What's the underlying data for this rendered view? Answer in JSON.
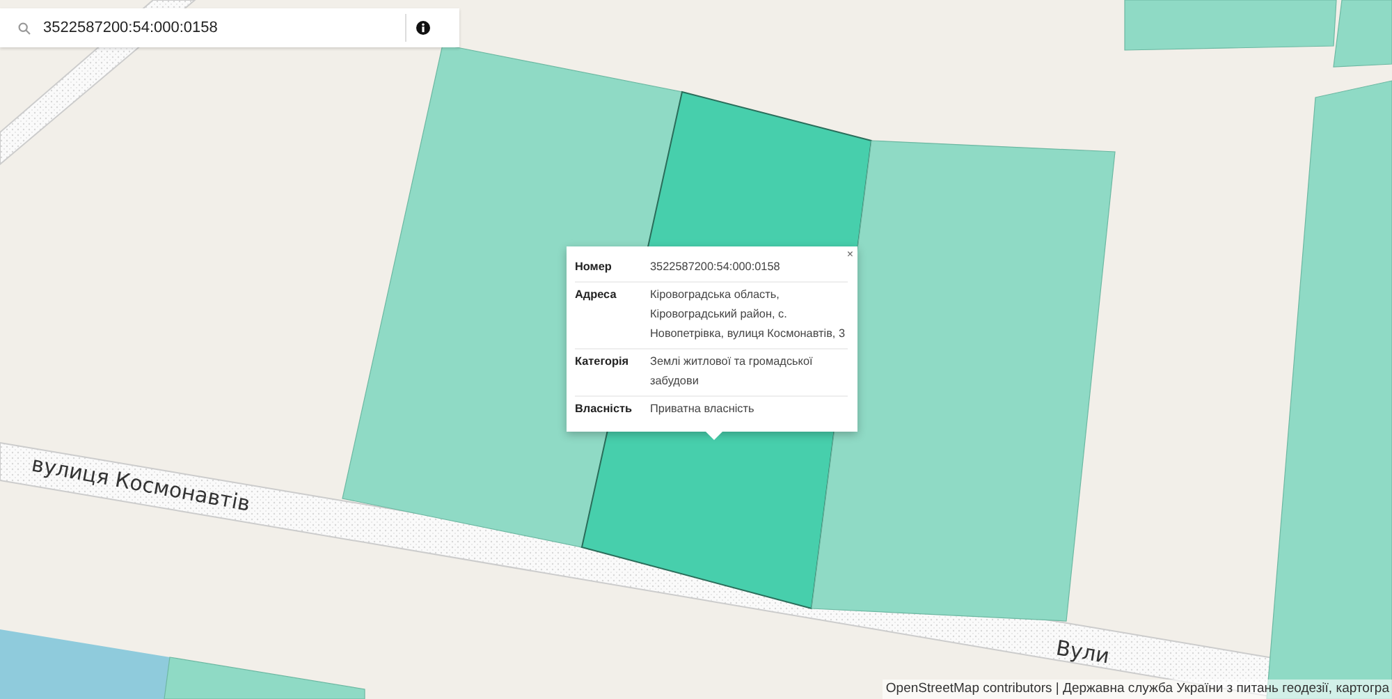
{
  "search": {
    "value": "3522587200:54:000:0158"
  },
  "map": {
    "parcels": [
      {
        "selected": false
      },
      {
        "selected": true
      },
      {
        "selected": false
      },
      {
        "selected": false
      },
      {
        "selected": false
      },
      {
        "selected": false
      },
      {
        "selected": false
      }
    ],
    "street_labels": [
      {
        "text": "вулиця Космонавтів"
      },
      {
        "text": "Вули"
      }
    ]
  },
  "popup": {
    "close": "×",
    "rows": [
      {
        "label": "Номер",
        "value": "3522587200:54:000:0158"
      },
      {
        "label": "Адреса",
        "value": "Кіровоградська область, Кіровоградський район, с. Новопетрівка, вулиця Космонавтів, 3"
      },
      {
        "label": "Категорія",
        "value": "Землі житлової та громадської забудови"
      },
      {
        "label": "Власність",
        "value": "Приватна власність"
      }
    ]
  },
  "attribution": "OpenStreetMap contributors | Державна служба України з питань геодезії, картогра"
}
